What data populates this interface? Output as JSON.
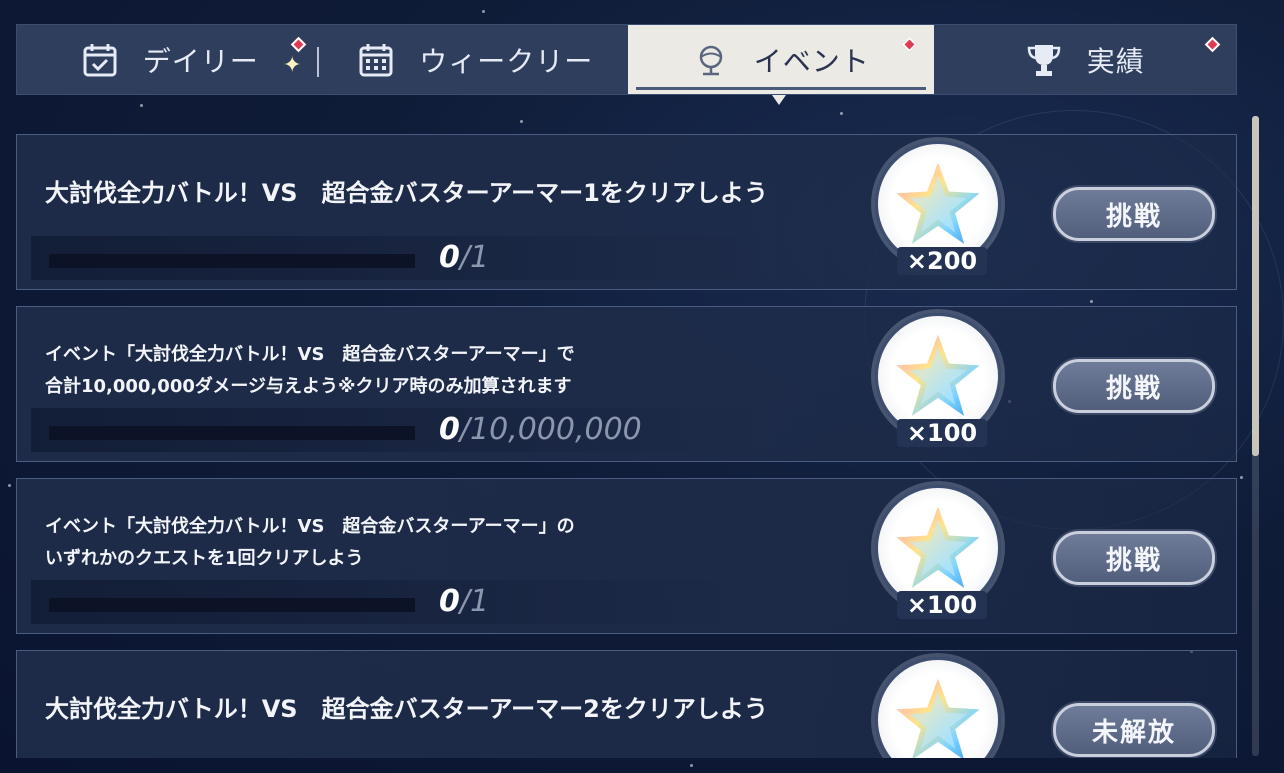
{
  "tabs": [
    {
      "label": "デイリー",
      "icon": "calendar-check-icon"
    },
    {
      "label": "ウィークリー",
      "icon": "calendar-week-icon"
    },
    {
      "label": "イベント",
      "icon": "globe-icon",
      "active": true
    },
    {
      "label": "実績",
      "icon": "trophy-icon"
    }
  ],
  "missions": [
    {
      "title": "大討伐全力バトル！VS　超合金バスターアーマー1をクリアしよう",
      "current": "0",
      "total": "1",
      "reward_qty": "×200",
      "action": "挑戦"
    },
    {
      "title_line1": "イベント「大討伐全力バトル！VS　超合金バスターアーマー」で",
      "title_line2": "合計10,000,000ダメージ与えよう※クリア時のみ加算されます",
      "current": "0",
      "total": "10,000,000",
      "reward_qty": "×100",
      "action": "挑戦"
    },
    {
      "title_line1": "イベント「大討伐全力バトル！VS　超合金バスターアーマー」の",
      "title_line2": "いずれかのクエストを1回クリアしよう",
      "current": "0",
      "total": "1",
      "reward_qty": "×100",
      "action": "挑戦"
    },
    {
      "title": "大討伐全力バトル！VS　超合金バスターアーマー2をクリアしよう",
      "action": "未解放"
    }
  ],
  "colors": {
    "badge": "#e03a55",
    "active_tab": "#eceae4",
    "panel": "#2f3e5c"
  }
}
